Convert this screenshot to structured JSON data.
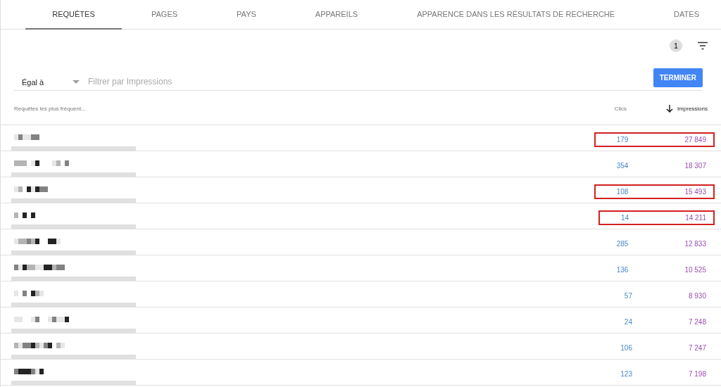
{
  "tabs": [
    {
      "label": "REQUÊTES",
      "selected": true
    },
    {
      "label": "PAGES",
      "selected": false
    },
    {
      "label": "PAYS",
      "selected": false
    },
    {
      "label": "APPAREILS",
      "selected": false
    },
    {
      "label": "APPARENCE DANS LES RÉSULTATS DE RECHERCHE",
      "selected": false
    },
    {
      "label": "DATES",
      "selected": false
    }
  ],
  "filter_count": "1",
  "filter": {
    "operator": "Égal à",
    "placeholder": "Filtrer par Impressions",
    "button": "TERMINER"
  },
  "table": {
    "columns": [
      {
        "label": "Requêtes les plus fréquent...",
        "sorted": false
      },
      {
        "label": "Clics",
        "sorted": false
      },
      {
        "label": "Impressions",
        "sorted": true
      }
    ],
    "rows": [
      {
        "clicks": "179",
        "impressions": "27 849",
        "highlighted": true
      },
      {
        "clicks": "354",
        "impressions": "18 307",
        "highlighted": false
      },
      {
        "clicks": "108",
        "impressions": "15 493",
        "highlighted": true
      },
      {
        "clicks": "14",
        "impressions": "14 211",
        "highlighted": true
      },
      {
        "clicks": "285",
        "impressions": "12 833",
        "highlighted": false
      },
      {
        "clicks": "136",
        "impressions": "10 525",
        "highlighted": false
      },
      {
        "clicks": "57",
        "impressions": "8 930",
        "highlighted": false
      },
      {
        "clicks": "24",
        "impressions": "7 248",
        "highlighted": false
      },
      {
        "clicks": "106",
        "impressions": "7 247",
        "highlighted": false
      },
      {
        "clicks": "123",
        "impressions": "7 198",
        "highlighted": false
      }
    ]
  }
}
